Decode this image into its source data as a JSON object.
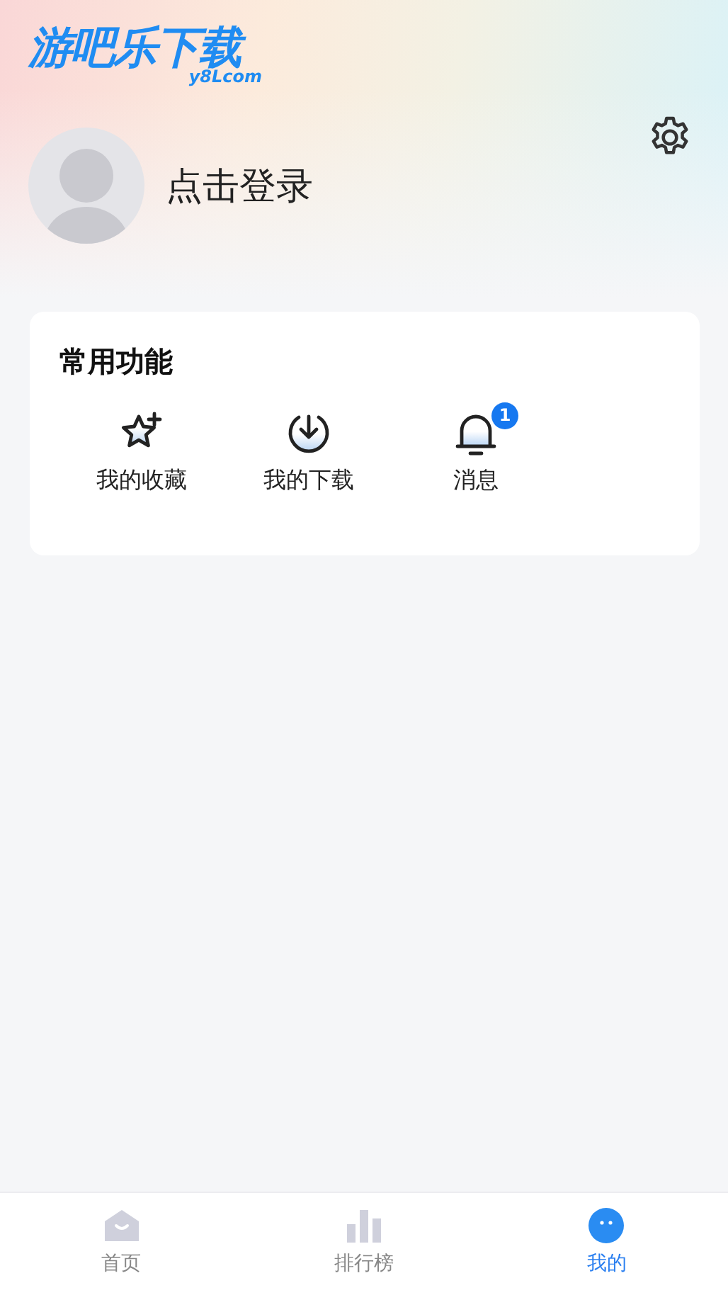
{
  "logo": {
    "title": "游吧乐下载",
    "subtitle": "y8Lcom"
  },
  "profile": {
    "login": "点击登录"
  },
  "functions": {
    "title": "常用功能",
    "items": [
      {
        "kind": "star",
        "label": "我的收藏"
      },
      {
        "kind": "download",
        "label": "我的下载"
      },
      {
        "kind": "bell",
        "label": "消息",
        "badge": "1"
      }
    ]
  },
  "tab_bar": [
    {
      "kind": "home",
      "label": "首页",
      "selected": false
    },
    {
      "kind": "chart",
      "label": "排行榜",
      "selected": false
    },
    {
      "kind": "me",
      "label": "我的",
      "selected": true
    }
  ]
}
